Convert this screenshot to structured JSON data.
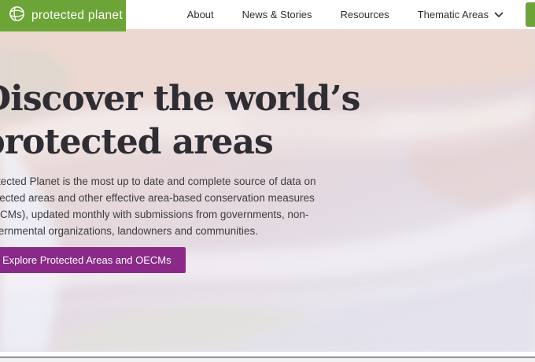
{
  "nav": {
    "logo": {
      "text": "protected planet",
      "mark": "®"
    },
    "items": [
      {
        "label": "About"
      },
      {
        "label": "News & Stories"
      },
      {
        "label": "Resources"
      },
      {
        "label": "Thematic Areas"
      }
    ]
  },
  "hero": {
    "heading_line1": "Discover the world’s",
    "heading_line2": "protected areas",
    "paragraph_lines": [
      "Protected Planet is the most up to date and complete source of data on",
      "protected areas and other effective area-based conservation measures",
      "(OECMs), updated monthly with submissions from governments, non-",
      "governmental organizations, landowners and communities."
    ],
    "cta_label": "Explore Protected Areas and OECMs"
  },
  "colors": {
    "brand_green": "#6CA437",
    "brand_purple": "#8A2988",
    "heading_text": "#2e2d33"
  }
}
